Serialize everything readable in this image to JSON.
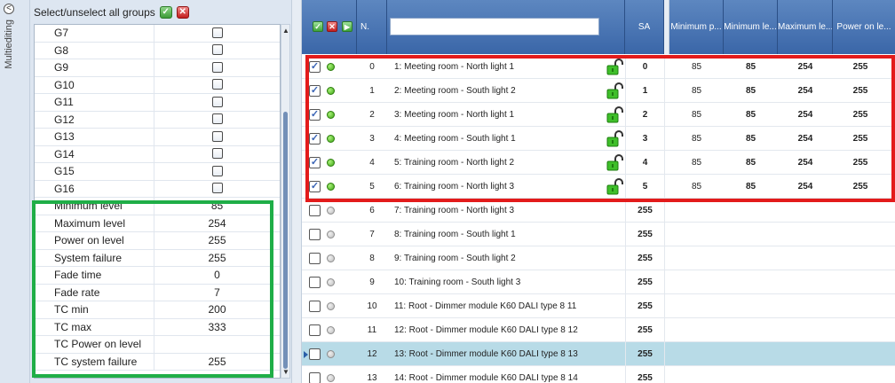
{
  "multiedit": {
    "collapse_glyph": "<",
    "vertical_label": "Multiediting"
  },
  "select_all": {
    "label": "Select/unselect all groups"
  },
  "groups": [
    {
      "label": "G7"
    },
    {
      "label": "G8"
    },
    {
      "label": "G9"
    },
    {
      "label": "G10"
    },
    {
      "label": "G11"
    },
    {
      "label": "G12"
    },
    {
      "label": "G13"
    },
    {
      "label": "G14"
    },
    {
      "label": "G15"
    },
    {
      "label": "G16"
    }
  ],
  "properties": [
    {
      "label": "Minimum level",
      "value": "85"
    },
    {
      "label": "Maximum level",
      "value": "254"
    },
    {
      "label": "Power on level",
      "value": "255"
    },
    {
      "label": "System failure",
      "value": "255"
    },
    {
      "label": "Fade time",
      "value": "0"
    },
    {
      "label": "Fade rate",
      "value": "7"
    },
    {
      "label": "TC min",
      "value": "200"
    },
    {
      "label": "TC max",
      "value": "333"
    },
    {
      "label": "TC Power on level",
      "value": ""
    },
    {
      "label": "TC system failure",
      "value": "255"
    }
  ],
  "grid": {
    "headers": {
      "n": "N.",
      "sa": "SA",
      "min_power": "Minimum p...",
      "min_level": "Minimum le...",
      "max_level": "Maximum le...",
      "power_on": "Power on le..."
    },
    "search_value": "",
    "rows": [
      {
        "checked": true,
        "online": true,
        "n": "0",
        "name": "1: Meeting room - North light 1",
        "sa": "0",
        "min_p": "85",
        "min_l": "85",
        "max_l": "254",
        "pwr": "255",
        "lock": true
      },
      {
        "checked": true,
        "online": true,
        "n": "1",
        "name": "2: Meeting room - South light  2",
        "sa": "1",
        "min_p": "85",
        "min_l": "85",
        "max_l": "254",
        "pwr": "255",
        "lock": true
      },
      {
        "checked": true,
        "online": true,
        "n": "2",
        "name": "3: Meeting room - North light  1",
        "sa": "2",
        "min_p": "85",
        "min_l": "85",
        "max_l": "254",
        "pwr": "255",
        "lock": true
      },
      {
        "checked": true,
        "online": true,
        "n": "3",
        "name": "4: Meeting room - South light 1",
        "sa": "3",
        "min_p": "85",
        "min_l": "85",
        "max_l": "254",
        "pwr": "255",
        "lock": true
      },
      {
        "checked": true,
        "online": true,
        "n": "4",
        "name": "5: Training room - North light 2",
        "sa": "4",
        "min_p": "85",
        "min_l": "85",
        "max_l": "254",
        "pwr": "255",
        "lock": true
      },
      {
        "checked": true,
        "online": true,
        "n": "5",
        "name": "6: Training room - North light 3",
        "sa": "5",
        "min_p": "85",
        "min_l": "85",
        "max_l": "254",
        "pwr": "255",
        "lock": true
      },
      {
        "checked": false,
        "online": false,
        "n": "6",
        "name": "7: Training room - North light 3",
        "sa": "255",
        "min_p": "",
        "min_l": "",
        "max_l": "",
        "pwr": "",
        "lock": false
      },
      {
        "checked": false,
        "online": false,
        "n": "7",
        "name": "8: Training room - South light 1",
        "sa": "255",
        "min_p": "",
        "min_l": "",
        "max_l": "",
        "pwr": "",
        "lock": false
      },
      {
        "checked": false,
        "online": false,
        "n": "8",
        "name": "9: Training room - South light 2",
        "sa": "255",
        "min_p": "",
        "min_l": "",
        "max_l": "",
        "pwr": "",
        "lock": false
      },
      {
        "checked": false,
        "online": false,
        "n": "9",
        "name": "10: Training room - South light 3",
        "sa": "255",
        "min_p": "",
        "min_l": "",
        "max_l": "",
        "pwr": "",
        "lock": false
      },
      {
        "checked": false,
        "online": false,
        "n": "10",
        "name": "11: Root - Dimmer module K60  DALI type 8 11",
        "sa": "255",
        "min_p": "",
        "min_l": "",
        "max_l": "",
        "pwr": "",
        "lock": false
      },
      {
        "checked": false,
        "online": false,
        "n": "11",
        "name": "12: Root - Dimmer module K60  DALI type 8 12",
        "sa": "255",
        "min_p": "",
        "min_l": "",
        "max_l": "",
        "pwr": "",
        "lock": false
      },
      {
        "checked": false,
        "online": false,
        "n": "12",
        "name": "13: Root - Dimmer module K60  DALI type 8 13",
        "sa": "255",
        "min_p": "",
        "min_l": "",
        "max_l": "",
        "pwr": "",
        "lock": false,
        "selected": true
      },
      {
        "checked": false,
        "online": false,
        "n": "13",
        "name": "14: Root - Dimmer module K60  DALI type 8 14",
        "sa": "255",
        "min_p": "",
        "min_l": "",
        "max_l": "",
        "pwr": "",
        "lock": false
      }
    ]
  },
  "colors": {
    "header_blue": "#4a76b5",
    "highlight_red": "#e31b1b",
    "highlight_green": "#1fae47",
    "selected_row": "#b8dbe7"
  }
}
